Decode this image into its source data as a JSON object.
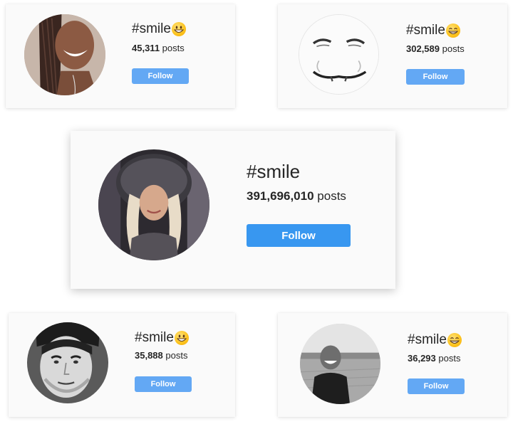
{
  "cards": [
    {
      "hashtag": "#smile",
      "count": "45,311",
      "posts_word": "posts",
      "follow_label": "Follow",
      "emoji": "grinning-face-emoji"
    },
    {
      "hashtag": "#smile",
      "count": "302,589",
      "posts_word": "posts",
      "follow_label": "Follow",
      "emoji": "beaming-face-emoji"
    },
    {
      "hashtag": "#smile",
      "count": "391,696,010",
      "posts_word": "posts",
      "follow_label": "Follow",
      "emoji": ""
    },
    {
      "hashtag": "#smile",
      "count": "35,888",
      "posts_word": "posts",
      "follow_label": "Follow",
      "emoji": "grinning-face-emoji"
    },
    {
      "hashtag": "#smile",
      "count": "36,293",
      "posts_word": "posts",
      "follow_label": "Follow",
      "emoji": "beaming-face-emoji"
    }
  ],
  "colors": {
    "follow_button": "#3897f0",
    "follow_button_light": "#63a8f4",
    "card_background": "#fafafa",
    "text": "#262626"
  }
}
